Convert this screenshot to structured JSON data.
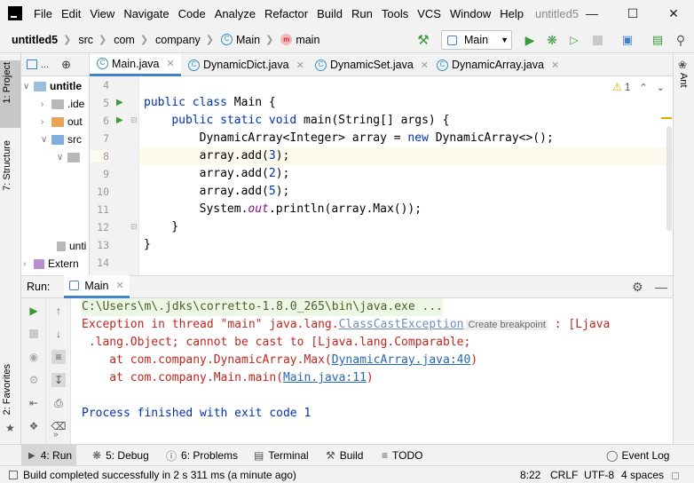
{
  "menubar": {
    "items": [
      "File",
      "Edit",
      "View",
      "Navigate",
      "Code",
      "Analyze",
      "Refactor",
      "Build",
      "Run",
      "Tools",
      "VCS",
      "Window",
      "Help"
    ],
    "title": "untitled5"
  },
  "breadcrumbs": {
    "project": "untitled5",
    "src": "src",
    "com": "com",
    "company": "company",
    "main_class": "Main",
    "main_method": "main"
  },
  "toolbar": {
    "run_config": "Main"
  },
  "left_strip": {
    "project_tab": "1: Project",
    "structure_tab": "7: Structure",
    "favorites_tab": "2: Favorites"
  },
  "right_strip": {
    "ant_tab": "Ant"
  },
  "project": {
    "header": "...",
    "rows": [
      "untitle",
      ".ide",
      "out",
      "src",
      "",
      "unti",
      "Extern"
    ]
  },
  "editor": {
    "tabs": [
      "Main.java",
      "DynamicDict.java",
      "DynamicSet.java",
      "DynamicArray.java"
    ],
    "warning_count": "1",
    "line_numbers": [
      "4",
      "5",
      "6",
      "7",
      "8",
      "9",
      "10",
      "11",
      "12",
      "13",
      "14"
    ]
  },
  "run_panel": {
    "label": "Run:",
    "config": "Main",
    "console": {
      "line1": "C:\\Users\\m\\.jdks\\corretto-1.8.0_265\\bin\\java.exe ...",
      "line2a": "Exception in thread \"main\" java.lang.",
      "line2_link": "ClassCastException",
      "line2_hint": "Create breakpoint",
      "line2b": " : [Ljava",
      "line3": " .lang.Object; cannot be cast to [Ljava.lang.Comparable;",
      "line4a": "    at com.company.DynamicArray.Max(",
      "line4_link": "DynamicArray.java:40",
      "line4b": ")",
      "line5a": "    at com.company.Main.main(",
      "line5_link": "Main.java:11",
      "line5b": ")",
      "line6": "Process finished with exit code 1"
    }
  },
  "bottom_tabs": {
    "run": "4: Run",
    "debug": "5: Debug",
    "problems": "6: Problems",
    "terminal": "Terminal",
    "build": "Build",
    "todo": "TODO",
    "event_log": "Event Log"
  },
  "status": {
    "message": "Build completed successfully in 2 s 311 ms (a minute ago)",
    "position": "8:22",
    "line_sep": "CRLF",
    "encoding": "UTF-8",
    "indent": "4 spaces"
  },
  "colors": {
    "accent": "#4083c9",
    "keyword": "#0033b3",
    "error": "#c0261e",
    "run_green": "#3a9a3a"
  }
}
